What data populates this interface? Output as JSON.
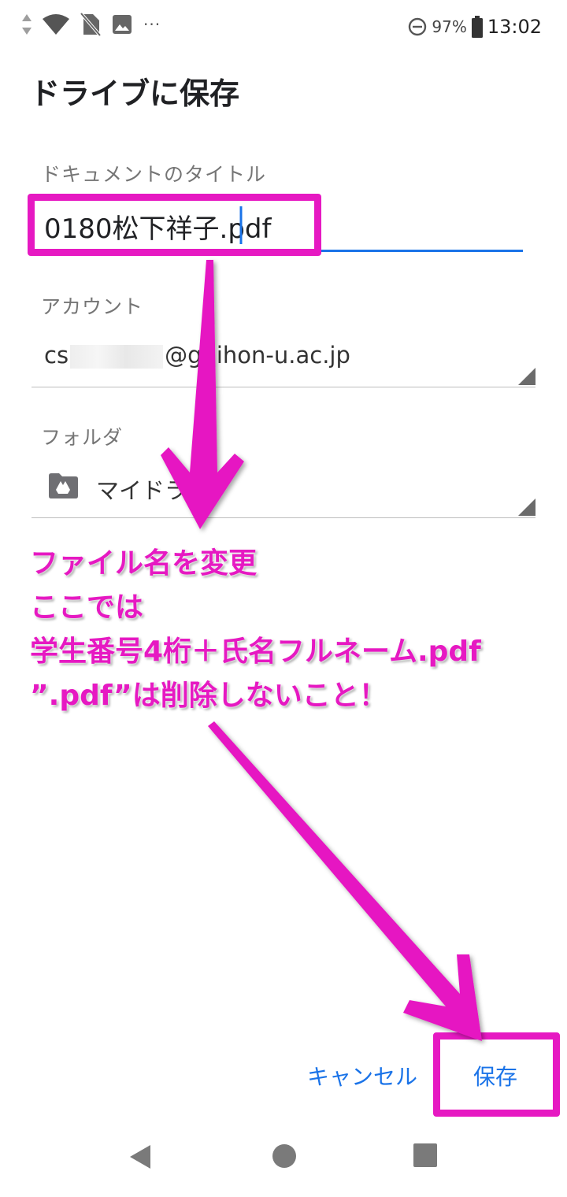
{
  "status_bar": {
    "battery_percent": "97%",
    "time": "13:02",
    "more": "···"
  },
  "dialog": {
    "title": "ドライブに保存",
    "doc_title_label": "ドキュメントのタイトル",
    "doc_title_value": "0180松下祥子.pdf",
    "account_label": "アカウント",
    "account_prefix": "cs",
    "account_suffix": "@gnihon-u.ac.jp",
    "folder_label": "フォルダ",
    "folder_value": "マイドラ",
    "cancel_label": "キャンセル",
    "save_label": "保存"
  },
  "annotation": {
    "lines": [
      "ファイル名を変更",
      "ここでは",
      "学生番号4桁＋氏名フルネーム.pdf",
      "”.pdf”は削除しないこと！"
    ],
    "color": "#e619c2"
  },
  "colors": {
    "accent": "#1a73e8",
    "annotation": "#e619c2"
  }
}
